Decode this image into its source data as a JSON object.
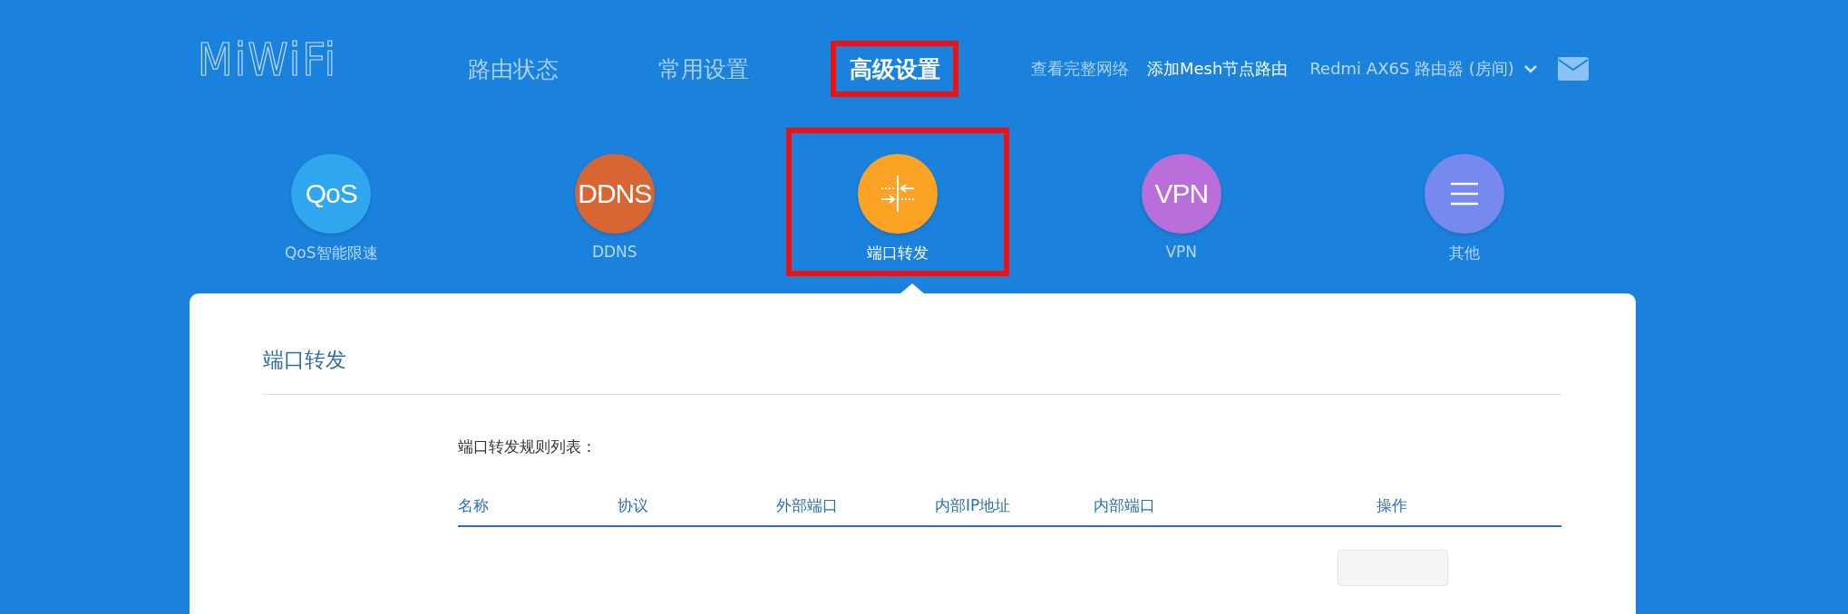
{
  "header": {
    "logo": "MiWiFi",
    "nav": [
      {
        "label": "路由状态",
        "selected": false,
        "highlighted": false
      },
      {
        "label": "常用设置",
        "selected": false,
        "highlighted": false
      },
      {
        "label": "高级设置",
        "selected": true,
        "highlighted": true
      }
    ],
    "links": [
      {
        "label": "查看完整网络",
        "kind": "dim"
      },
      {
        "label": "添加Mesh节点路由",
        "kind": "bright"
      }
    ],
    "device": {
      "label": "Redmi AX6S 路由器 (房间)"
    }
  },
  "features": [
    {
      "kind": "text",
      "glyph": "QoS",
      "label": "QoS智能限速",
      "color": "#2fa6ee",
      "selected": false,
      "highlighted": false
    },
    {
      "kind": "text",
      "glyph": "DDNS",
      "label": "DDNS",
      "color": "#d86534",
      "selected": false,
      "highlighted": false
    },
    {
      "kind": "ports",
      "label": "端口转发",
      "color": "#fca326",
      "selected": true,
      "highlighted": true
    },
    {
      "kind": "text",
      "glyph": "VPN",
      "label": "VPN",
      "color": "#b96ed9",
      "selected": false,
      "highlighted": false
    },
    {
      "kind": "menu",
      "label": "其他",
      "color": "#7789ee",
      "selected": false,
      "highlighted": false
    }
  ],
  "panel": {
    "title": "端口转发",
    "list_title": "端口转发规则列表：",
    "table": {
      "columns": [
        "名称",
        "协议",
        "外部端口",
        "内部IP地址",
        "内部端口",
        "操作"
      ],
      "footer_button": {
        "kind": "button"
      }
    }
  }
}
